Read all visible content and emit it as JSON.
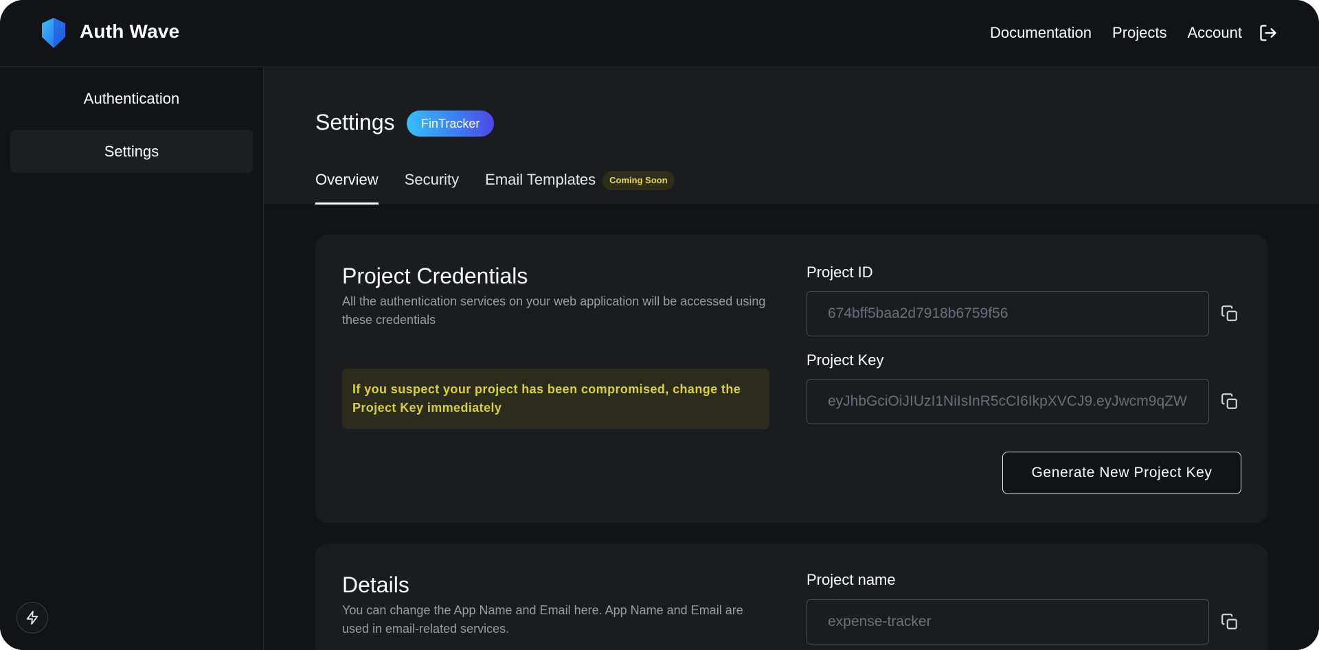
{
  "header": {
    "brand": "Auth Wave",
    "nav": [
      "Documentation",
      "Projects",
      "Account"
    ]
  },
  "sidebar": {
    "items": [
      {
        "label": "Authentication",
        "active": false
      },
      {
        "label": "Settings",
        "active": true
      }
    ]
  },
  "page": {
    "title": "Settings",
    "project_badge": "FinTracker",
    "tabs": [
      {
        "label": "Overview",
        "active": true
      },
      {
        "label": "Security",
        "active": false
      },
      {
        "label": "Email Templates",
        "active": false,
        "badge": "Coming Soon"
      }
    ]
  },
  "credentials": {
    "title": "Project Credentials",
    "description": "All the authentication services on your web application will be accessed using these credentials",
    "warning": "If you suspect your project has been compromised, change the Project Key immediately",
    "project_id_label": "Project ID",
    "project_id_value": "674bff5baa2d7918b6759f56",
    "project_key_label": "Project Key",
    "project_key_value": "eyJhbGciOiJIUzI1NiIsInR5cCI6IkpXVCJ9.eyJwcm9qZW",
    "generate_button": "Generate New Project Key"
  },
  "details": {
    "title": "Details",
    "description": "You can change the App Name and Email here. App Name and Email are used in email-related services.",
    "project_name_label": "Project name",
    "project_name_value": "expense-tracker"
  },
  "colors": {
    "accent_gradient_start": "#38bdf8",
    "accent_gradient_end": "#4f46e5",
    "warning_text": "#d8d13c",
    "background": "#121316"
  }
}
